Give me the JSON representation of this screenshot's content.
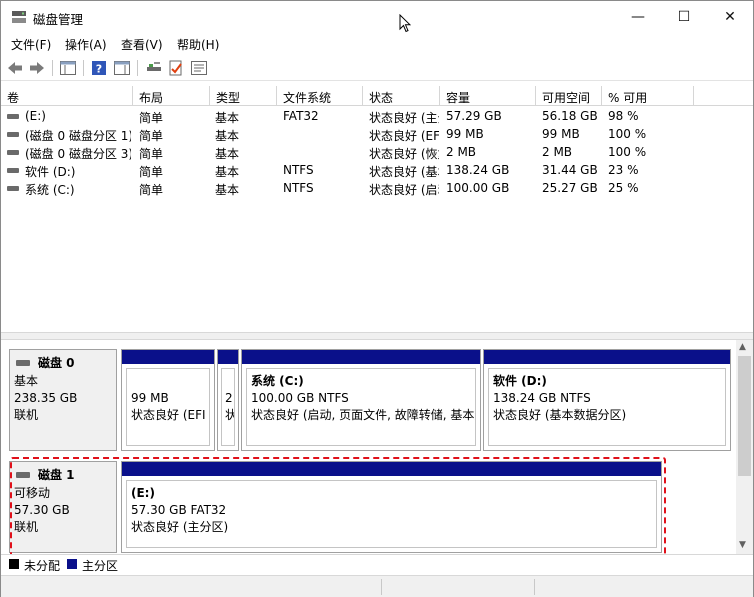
{
  "window": {
    "title": "磁盘管理",
    "minimize_glyph": "—",
    "maximize_glyph": "☐",
    "close_glyph": "✕"
  },
  "menu": [
    "文件(F)",
    "操作(A)",
    "查看(V)",
    "帮助(H)"
  ],
  "toolbar": {
    "icons": [
      "back-icon",
      "forward-icon",
      "console-tree-icon",
      "help-icon",
      "action-pane-icon",
      "connect-icon",
      "properties-icon",
      "settings-icon"
    ]
  },
  "volume_table": {
    "headers": [
      "卷",
      "布局",
      "类型",
      "文件系统",
      "状态",
      "容量",
      "可用空间",
      "% 可用"
    ],
    "rows": [
      {
        "volume": "(E:)",
        "layout": "简单",
        "type": "基本",
        "fs": "FAT32",
        "status": "状态良好 (主分区)",
        "capacity": "57.29 GB",
        "free": "56.18 GB",
        "pct": "98 %"
      },
      {
        "volume": "(磁盘 0 磁盘分区 1)",
        "layout": "简单",
        "type": "基本",
        "fs": "",
        "status": "状态良好 (EFI 系统分区)",
        "capacity": "99 MB",
        "free": "99 MB",
        "pct": "100 %"
      },
      {
        "volume": "(磁盘 0 磁盘分区 3)",
        "layout": "简单",
        "type": "基本",
        "fs": "",
        "status": "状态良好 (恢复分区)",
        "capacity": "2 MB",
        "free": "2 MB",
        "pct": "100 %"
      },
      {
        "volume": "软件 (D:)",
        "layout": "简单",
        "type": "基本",
        "fs": "NTFS",
        "status": "状态良好 (基本数据分区)",
        "capacity": "138.24 GB",
        "free": "31.44 GB",
        "pct": "23 %"
      },
      {
        "volume": "系统 (C:)",
        "layout": "简单",
        "type": "基本",
        "fs": "NTFS",
        "status": "状态良好 (启动, 页面文件, 故障转储, 基本数据分区)",
        "capacity": "100.00 GB",
        "free": "25.27 GB",
        "pct": "25 %"
      }
    ]
  },
  "disks": [
    {
      "name": "磁盘 0",
      "type": "基本",
      "size": "238.35 GB",
      "status": "联机",
      "partitions": [
        {
          "name": "",
          "size": "99 MB",
          "status": "状态良好 (EFI 系统分区)"
        },
        {
          "name": "",
          "size": "2",
          "status": "状态良好 (恢复分区)"
        },
        {
          "name": "系统  (C:)",
          "size": "100.00 GB NTFS",
          "status": "状态良好 (启动, 页面文件, 故障转储, 基本数据分区)"
        },
        {
          "name": "软件  (D:)",
          "size": "138.24 GB NTFS",
          "status": "状态良好 (基本数据分区)"
        }
      ]
    },
    {
      "name": "磁盘 1",
      "type": "可移动",
      "size": "57.30 GB",
      "status": "联机",
      "partitions": [
        {
          "name": "(E:)",
          "size": "57.30 GB FAT32",
          "status": "状态良好 (主分区)"
        }
      ]
    }
  ],
  "legend": [
    {
      "label": "未分配",
      "color": "#000000"
    },
    {
      "label": "主分区",
      "color": "#0a108a"
    }
  ],
  "colors": {
    "primary_partition": "#0a108a",
    "highlight": "#e0101a"
  }
}
